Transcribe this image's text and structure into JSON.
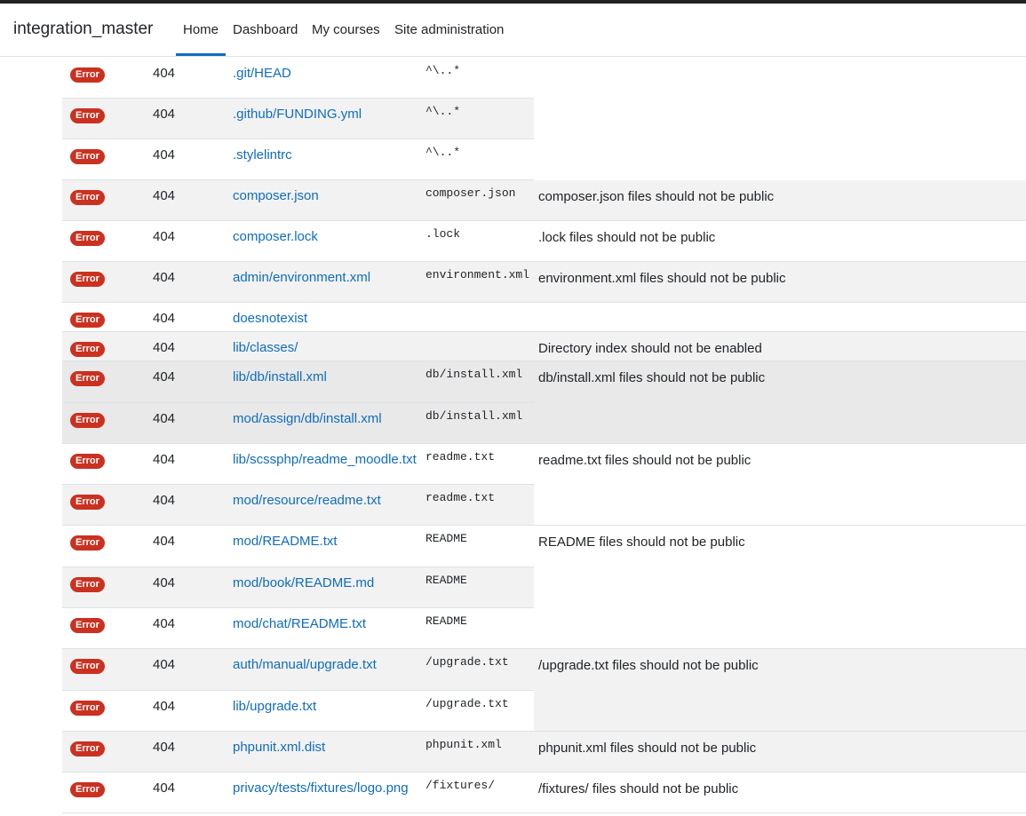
{
  "navbar": {
    "brand": "integration_master",
    "items": [
      {
        "label": "Home",
        "active": true
      },
      {
        "label": "Dashboard",
        "active": false
      },
      {
        "label": "My courses",
        "active": false
      },
      {
        "label": "Site administration",
        "active": false
      }
    ]
  },
  "colors": {
    "error_badge": "#ca3120",
    "link": "#0f6cbf",
    "stripe": "#f2f2f2",
    "hover": "#e9e9e9"
  },
  "rows": [
    {
      "status": "Error",
      "code": "404",
      "path": ".git/HEAD",
      "regex": "^\\..*"
    },
    {
      "status": "Error",
      "code": "404",
      "path": ".github/FUNDING.yml",
      "regex": "^\\..*"
    },
    {
      "status": "Error",
      "code": "404",
      "path": ".stylelintrc",
      "regex": "^\\..*"
    },
    {
      "status": "Error",
      "code": "404",
      "path": "composer.json",
      "regex": "composer.json"
    },
    {
      "status": "Error",
      "code": "404",
      "path": "composer.lock",
      "regex": ".lock"
    },
    {
      "status": "Error",
      "code": "404",
      "path": "admin/environment.xml",
      "regex": "environment.xml"
    },
    {
      "status": "Error",
      "code": "404",
      "path": "doesnotexist",
      "regex": ""
    },
    {
      "status": "Error",
      "code": "404",
      "path": "lib/classes/",
      "regex": ""
    },
    {
      "status": "Error",
      "code": "404",
      "path": "lib/db/install.xml",
      "regex": "db/install.xml"
    },
    {
      "status": "Error",
      "code": "404",
      "path": "mod/assign/db/install.xml",
      "regex": "db/install.xml"
    },
    {
      "status": "Error",
      "code": "404",
      "path": "lib/scssphp/readme_moodle.txt",
      "regex": "readme.txt"
    },
    {
      "status": "Error",
      "code": "404",
      "path": "mod/resource/readme.txt",
      "regex": "readme.txt"
    },
    {
      "status": "Error",
      "code": "404",
      "path": "mod/README.txt",
      "regex": "README"
    },
    {
      "status": "Error",
      "code": "404",
      "path": "mod/book/README.md",
      "regex": "README"
    },
    {
      "status": "Error",
      "code": "404",
      "path": "mod/chat/README.txt",
      "regex": "README"
    },
    {
      "status": "Error",
      "code": "404",
      "path": "auth/manual/upgrade.txt",
      "regex": "/upgrade.txt"
    },
    {
      "status": "Error",
      "code": "404",
      "path": "lib/upgrade.txt",
      "regex": "/upgrade.txt"
    },
    {
      "status": "Error",
      "code": "404",
      "path": "phpunit.xml.dist",
      "regex": "phpunit.xml"
    },
    {
      "status": "Error",
      "code": "404",
      "path": "privacy/tests/fixtures/logo.png",
      "regex": "/fixtures/"
    }
  ],
  "descriptions": [
    {
      "text": "",
      "first": 0,
      "count": 3
    },
    {
      "text": "composer.json files should not be public",
      "first": 3,
      "count": 1
    },
    {
      "text": ".lock files should not be public",
      "first": 4,
      "count": 1
    },
    {
      "text": "environment.xml files should not be public",
      "first": 5,
      "count": 1
    },
    {
      "text": "",
      "first": 6,
      "count": 1
    },
    {
      "text": "Directory index should not be enabled",
      "first": 7,
      "count": 1
    },
    {
      "text": "db/install.xml files should not be public",
      "first": 8,
      "count": 2
    },
    {
      "text": "readme.txt files should not be public",
      "first": 10,
      "count": 2
    },
    {
      "text": "README files should not be public",
      "first": 12,
      "count": 3
    },
    {
      "text": "/upgrade.txt files should not be public",
      "first": 15,
      "count": 2
    },
    {
      "text": "phpunit.xml files should not be public",
      "first": 17,
      "count": 1
    },
    {
      "text": "/fixtures/ files should not be public",
      "first": 18,
      "count": 1
    }
  ]
}
